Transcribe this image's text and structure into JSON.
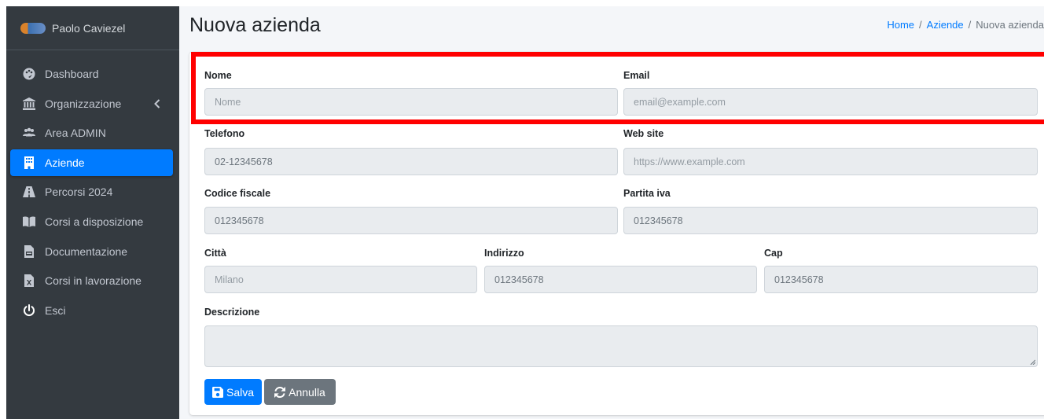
{
  "sidebar": {
    "user_name": "Paolo Caviezel",
    "items": [
      {
        "label": "Dashboard",
        "icon": "palette-icon"
      },
      {
        "label": "Organizzazione",
        "icon": "bank-icon"
      },
      {
        "label": "Area ADMIN",
        "icon": "users-icon"
      },
      {
        "label": "Aziende",
        "icon": "building-icon",
        "active": true
      },
      {
        "label": "Percorsi 2024",
        "icon": "road-icon"
      },
      {
        "label": "Corsi a disposizione",
        "icon": "book-icon"
      },
      {
        "label": "Documentazione",
        "icon": "pdf-file-icon"
      },
      {
        "label": "Corsi in lavorazione",
        "icon": "excel-file-icon"
      },
      {
        "label": "Esci",
        "icon": "power-icon"
      }
    ]
  },
  "header": {
    "title": "Nuova azienda",
    "breadcrumb": [
      "Home",
      "Aziende",
      "Nuova azienda"
    ]
  },
  "form": {
    "nome": {
      "label": "Nome",
      "placeholder": "Nome"
    },
    "email": {
      "label": "Email",
      "placeholder": "email@example.com"
    },
    "telefono": {
      "label": "Telefono",
      "placeholder": "02-12345678"
    },
    "website": {
      "label": "Web site",
      "placeholder": "https://www.example.com"
    },
    "codice_fiscale": {
      "label": "Codice fiscale",
      "placeholder": "012345678"
    },
    "partita_iva": {
      "label": "Partita iva",
      "placeholder": "012345678"
    },
    "citta": {
      "label": "Città",
      "placeholder": "Milano"
    },
    "indirizzo": {
      "label": "Indirizzo",
      "placeholder": "012345678"
    },
    "cap": {
      "label": "Cap",
      "placeholder": "012345678"
    },
    "descrizione": {
      "label": "Descrizione",
      "value": ""
    }
  },
  "buttons": {
    "save_label": "Salva",
    "cancel_label": "Annulla"
  },
  "colors": {
    "sidebar_bg": "#343a40",
    "accent": "#007bff",
    "secondary": "#6c757d",
    "highlight": "#ff0000"
  }
}
